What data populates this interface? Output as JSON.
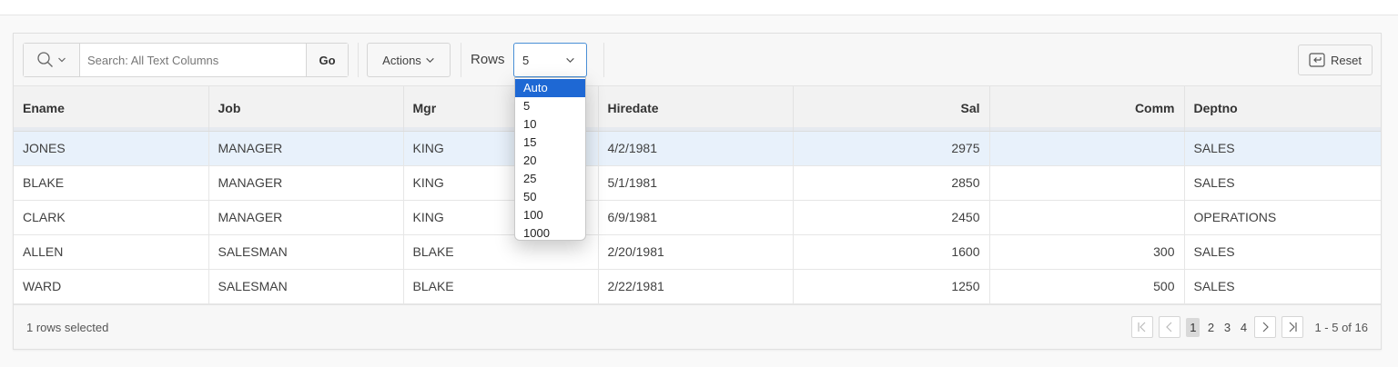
{
  "search": {
    "placeholder": "Search: All Text Columns",
    "go_label": "Go",
    "column_icon": "magnifier-icon"
  },
  "toolbar": {
    "actions_label": "Actions",
    "rows_label": "Rows",
    "rows_value": "5",
    "reset_label": "Reset",
    "reset_icon": "reset-arrow-icon"
  },
  "rows_dropdown": {
    "options": [
      "Auto",
      "5",
      "10",
      "15",
      "20",
      "25",
      "50",
      "100",
      "1000"
    ],
    "highlighted": "Auto"
  },
  "table": {
    "headers": {
      "ename": "Ename",
      "job": "Job",
      "mgr": "Mgr",
      "hiredate": "Hiredate",
      "sal": "Sal",
      "comm": "Comm",
      "deptno": "Deptno"
    },
    "rows": [
      {
        "ename": "JONES",
        "job": "MANAGER",
        "mgr": "KING",
        "hiredate": "4/2/1981",
        "sal": "2975",
        "comm": "",
        "deptno": "SALES",
        "selected": true
      },
      {
        "ename": "BLAKE",
        "job": "MANAGER",
        "mgr": "KING",
        "hiredate": "5/1/1981",
        "sal": "2850",
        "comm": "",
        "deptno": "SALES",
        "selected": false
      },
      {
        "ename": "CLARK",
        "job": "MANAGER",
        "mgr": "KING",
        "hiredate": "6/9/1981",
        "sal": "2450",
        "comm": "",
        "deptno": "OPERATIONS",
        "selected": false
      },
      {
        "ename": "ALLEN",
        "job": "SALESMAN",
        "mgr": "BLAKE",
        "hiredate": "2/20/1981",
        "sal": "1600",
        "comm": "300",
        "deptno": "SALES",
        "selected": false
      },
      {
        "ename": "WARD",
        "job": "SALESMAN",
        "mgr": "BLAKE",
        "hiredate": "2/22/1981",
        "sal": "1250",
        "comm": "500",
        "deptno": "SALES",
        "selected": false
      }
    ]
  },
  "footer": {
    "selected_text": "1 rows selected",
    "pages": [
      "1",
      "2",
      "3",
      "4"
    ],
    "current_page": "1",
    "range_text": "1 - 5 of 16"
  },
  "colors": {
    "selected_row": "#e8f1fb",
    "dropdown_highlight": "#1e68d4",
    "focus_border": "#4a8fd6"
  }
}
